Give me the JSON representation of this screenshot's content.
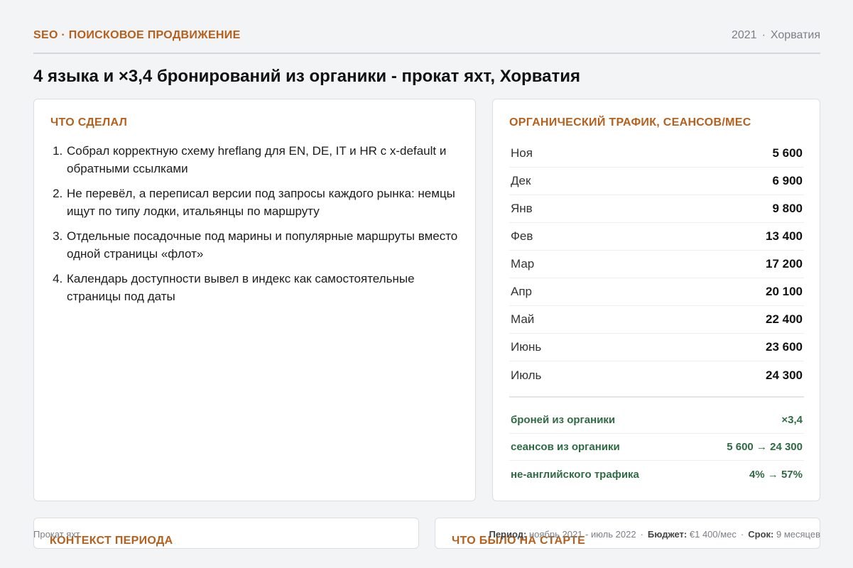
{
  "header": {
    "eyebrow": "SEO · ПОИСКОВОЕ ПРОДВИЖЕНИЕ",
    "year": "2021",
    "separator": "·",
    "country": "Хорватия"
  },
  "title": "4 языка и ×3,4 бронирований из органики - прокат яхт, Хорватия",
  "done": {
    "heading": "ЧТО СДЕЛАЛ",
    "items": [
      "Собрал корректную схему hreflang для EN, DE, IT и HR с x-default и обратными ссылками",
      "Не перевёл, а переписал версии под запросы каждого рынка: немцы ищут по типу лодки, итальянцы по маршруту",
      "Отдельные посадочные под марины и популярные маршруты вместо одной страницы «флот»",
      "Календарь доступности вывел в индекс как самостоятельные страницы под даты"
    ]
  },
  "traffic": {
    "heading": "ОРГАНИЧЕСКИЙ ТРАФИК, СЕАНСОВ/МЕС",
    "rows": [
      {
        "month": "Ноя",
        "value": "5 600"
      },
      {
        "month": "Дек",
        "value": "6 900"
      },
      {
        "month": "Янв",
        "value": "9 800"
      },
      {
        "month": "Фев",
        "value": "13 400"
      },
      {
        "month": "Мар",
        "value": "17 200"
      },
      {
        "month": "Апр",
        "value": "20 100"
      },
      {
        "month": "Май",
        "value": "22 400"
      },
      {
        "month": "Июнь",
        "value": "23 600"
      },
      {
        "month": "Июль",
        "value": "24 300"
      }
    ],
    "stats": [
      {
        "label": "броней из органики",
        "value": "×3,4"
      },
      {
        "label": "сеансов из органики",
        "value": "5 600 → 24 300"
      },
      {
        "label": "не-английского трафика",
        "value": "4% → 57%"
      }
    ]
  },
  "bottom": {
    "context_heading": "КОНТЕКСТ ПЕРИОДА",
    "start_heading": "ЧТО БЫЛО НА СТАРТЕ"
  },
  "footer": {
    "project": "Прокат яхт",
    "period_label": "Период:",
    "period_value": "ноябрь 2021 - июль 2022",
    "budget_label": "Бюджет:",
    "budget_value": "€1 400/мес",
    "term_label": "Срок:",
    "term_value": "9 месяцев",
    "separator": "·"
  }
}
